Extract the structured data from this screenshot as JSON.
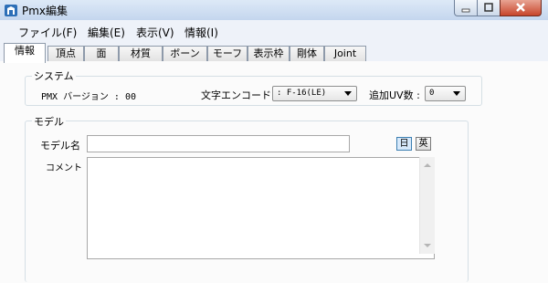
{
  "window": {
    "title": "Pmx編集"
  },
  "menu": [
    "ファイル(F)",
    "編集(E)",
    "表示(V)",
    "情報(I)"
  ],
  "tabs": [
    "情報",
    "頂点",
    "面",
    "材質",
    "ボーン",
    "モーフ",
    "表示枠",
    "剛体",
    "Joint"
  ],
  "active_tab": "情報",
  "system": {
    "title": "システム",
    "version_label": "PMX バージョン : 00",
    "encoding_label": "文字エンコード",
    "encoding_value": ": F-16(LE)",
    "uv_label": "追加UV数 :",
    "uv_value": "0"
  },
  "model": {
    "title": "モデル",
    "name_label": "モデル名",
    "name_value": "",
    "comment_label": "コメント",
    "comment_value": "",
    "lang_jp": "日",
    "lang_en": "英"
  },
  "colors": {
    "titlebar": "#c9daf0",
    "menubar": "#eef2f9",
    "close": "#c7452b"
  }
}
